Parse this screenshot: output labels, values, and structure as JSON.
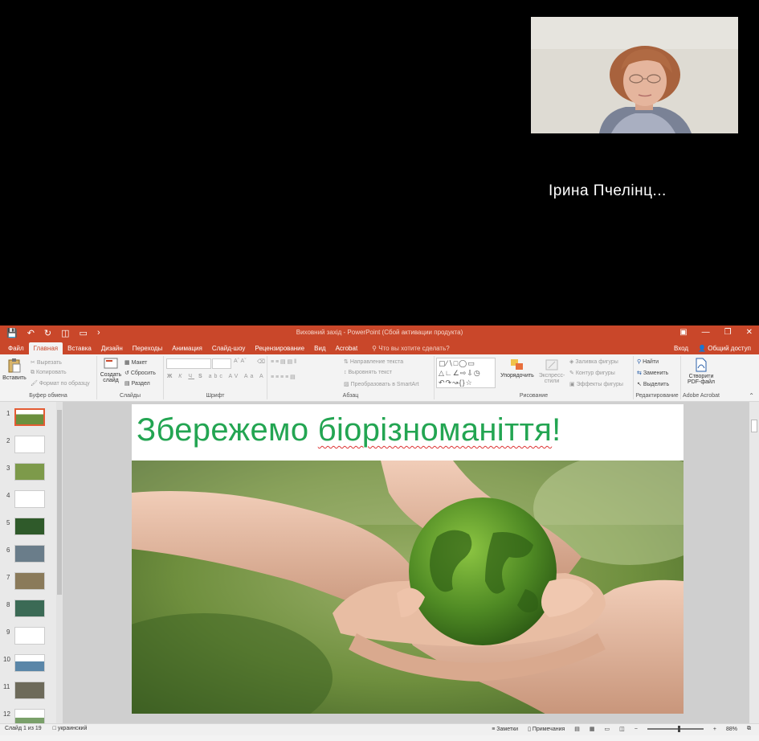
{
  "video": {
    "participant_name": "Ірина Пчелінц..."
  },
  "window": {
    "title": "Виховний захід - PowerPoint (Сбой активации продукта)",
    "tabs": [
      "Файл",
      "Главная",
      "Вставка",
      "Дизайн",
      "Переходы",
      "Анимация",
      "Слайд-шоу",
      "Рецензирование",
      "Вид",
      "Acrobat"
    ],
    "active_tab": "Главная",
    "search_hint": "Что вы хотите сделать?",
    "signin": "Вход",
    "share": "Общий доступ"
  },
  "ribbon": {
    "clipboard": {
      "paste": "Вставить",
      "cut": "Вырезать",
      "copy": "Копировать",
      "format_painter": "Формат по образцу",
      "label": "Буфер обмена"
    },
    "slides": {
      "new_slide": "Создать слайд",
      "layout": "Макет",
      "reset": "Сбросить",
      "section": "Раздел",
      "label": "Слайды"
    },
    "font": {
      "bold": "Ж",
      "italic": "К",
      "underline": "Ч",
      "strike": "S",
      "label": "Шрифт"
    },
    "paragraph": {
      "text_direction": "Направление текста",
      "align_text": "Выровнять текст",
      "smartart": "Преобразовать в SmartArt",
      "label": "Абзац"
    },
    "drawing": {
      "arrange": "Упорядочить",
      "quick_styles": "Экспресс-стили",
      "shape_fill": "Заливка фигуры",
      "shape_outline": "Контур фигуры",
      "shape_effects": "Эффекты фигуры",
      "label": "Рисование"
    },
    "editing": {
      "find": "Найти",
      "replace": "Заменить",
      "select": "Выделить",
      "label": "Редактирование"
    },
    "acrobat": {
      "create_pdf": "Створити PDF-файл",
      "label": "Adobe Acrobat"
    }
  },
  "slide_numbers": [
    "1",
    "2",
    "3",
    "4",
    "5",
    "6",
    "7",
    "8",
    "9",
    "10",
    "11",
    "12"
  ],
  "slide": {
    "title_part1": "Збережемо ",
    "title_part2": "біорізноманіття",
    "title_part3": "!"
  },
  "status": {
    "slide_info": "Слайд 1 из 19",
    "language": "украинский",
    "notes": "Заметки",
    "comments": "Примечания",
    "zoom": "88%"
  }
}
